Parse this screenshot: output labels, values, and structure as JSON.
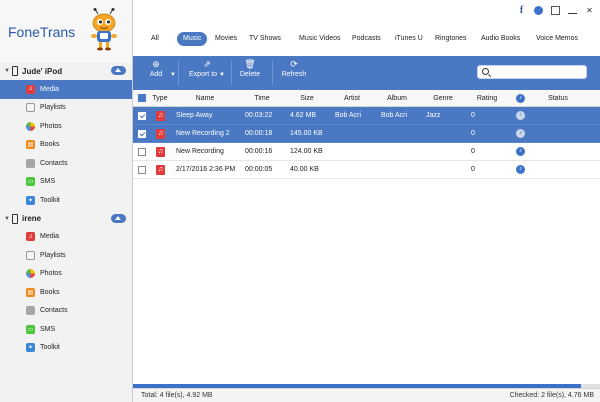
{
  "app": {
    "title": "FoneTrans"
  },
  "devices": [
    {
      "name": "Jude' iPod",
      "items": [
        {
          "label": "Media",
          "icon": "music-note-icon",
          "active": true
        },
        {
          "label": "Playlists",
          "icon": "playlist-icon"
        },
        {
          "label": "Photos",
          "icon": "photos-icon"
        },
        {
          "label": "Books",
          "icon": "book-icon"
        },
        {
          "label": "Contacts",
          "icon": "contacts-icon"
        },
        {
          "label": "SMS",
          "icon": "sms-icon"
        },
        {
          "label": "Toolkit",
          "icon": "toolkit-icon"
        }
      ]
    },
    {
      "name": "irene",
      "items": [
        {
          "label": "Media",
          "icon": "music-note-icon"
        },
        {
          "label": "Playlists",
          "icon": "playlist-icon"
        },
        {
          "label": "Photos",
          "icon": "photos-icon"
        },
        {
          "label": "Books",
          "icon": "book-icon"
        },
        {
          "label": "Contacts",
          "icon": "contacts-icon"
        },
        {
          "label": "SMS",
          "icon": "sms-icon"
        },
        {
          "label": "Toolkit",
          "icon": "toolkit-icon"
        }
      ]
    }
  ],
  "category_tabs": [
    "All",
    "Music",
    "Movies",
    "TV Shows",
    "Music Videos",
    "Podcasts",
    "iTunes U",
    "Ringtones",
    "Audio Books",
    "Voice Memos"
  ],
  "active_category": "Music",
  "toolbar": {
    "add_label": "Add",
    "export_label": "Export to",
    "delete_label": "Delete",
    "refresh_label": "Refresh",
    "search_placeholder": ""
  },
  "columns": [
    "Type",
    "Name",
    "Time",
    "Size",
    "Artist",
    "Album",
    "Genre",
    "Rating",
    "Status"
  ],
  "rows": [
    {
      "checked": true,
      "selected": true,
      "name": "Sleep Away",
      "time": "00:03:22",
      "size": "4.62 MB",
      "artist": "Bob Acri",
      "album": "Bob Acri",
      "genre": "Jazz",
      "rating": "0"
    },
    {
      "checked": true,
      "selected": true,
      "name": "New Recording 2",
      "time": "00:00:18",
      "size": "145.00 KB",
      "artist": "",
      "album": "",
      "genre": "",
      "rating": "0"
    },
    {
      "checked": false,
      "selected": false,
      "name": "New Recording",
      "time": "00:00:16",
      "size": "124.00 KB",
      "artist": "",
      "album": "",
      "genre": "",
      "rating": "0"
    },
    {
      "checked": false,
      "selected": false,
      "name": "2/17/2016 2:36 PM",
      "time": "00:00:05",
      "size": "40.00 KB",
      "artist": "",
      "album": "",
      "genre": "",
      "rating": "0"
    }
  ],
  "status": {
    "total": "Total: 4 file(s), 4.92 MB",
    "checked": "Checked: 2 file(s), 4.76 MB",
    "progress_fraction": 0.96
  },
  "colors": {
    "accent": "#4a78c2",
    "brand_text": "#2b5aa8",
    "music_icon": "#e23b3b"
  }
}
